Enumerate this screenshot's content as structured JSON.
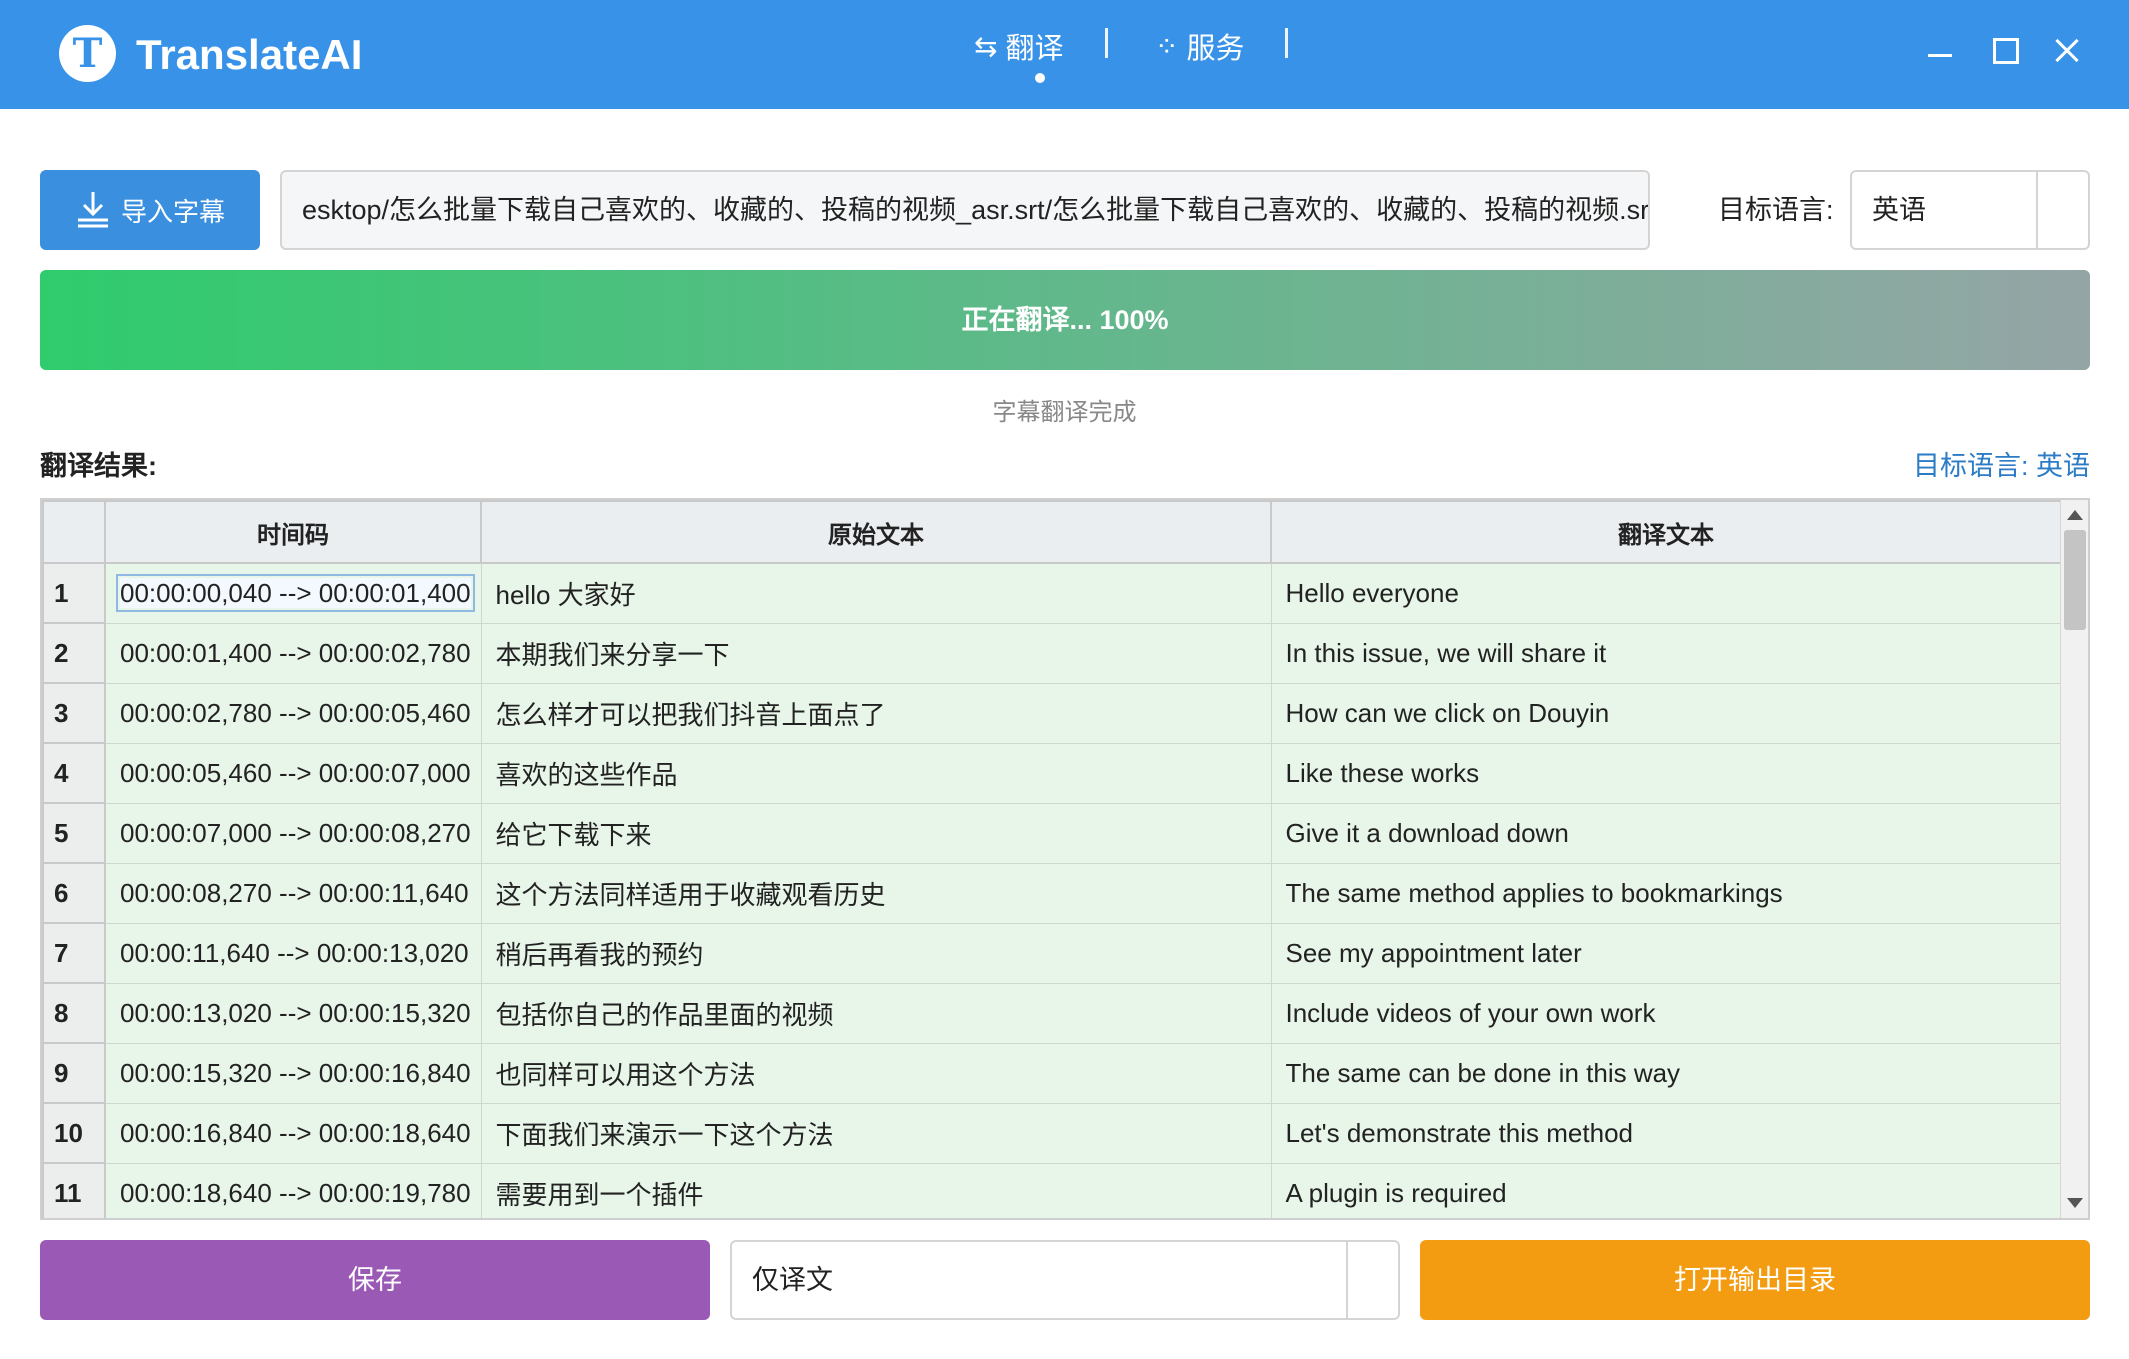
{
  "app": {
    "title": "TranslateAI",
    "logo_letter": "T"
  },
  "nav": {
    "translate_icon": "⇆",
    "translate_label": "翻译",
    "service_icon": "⁘",
    "service_label": "服务",
    "active_tab": "翻译"
  },
  "toolbar": {
    "import_label": "导入字幕",
    "file_path": "esktop/怎么批量下载自己喜欢的、收藏的、投稿的视频_asr.srt/怎么批量下载自己喜欢的、收藏的、投稿的视频.srt",
    "target_label": "目标语言:",
    "target_value": "英语"
  },
  "progress": {
    "text": "正在翻译... 100%",
    "percent": 100,
    "status": "字幕翻译完成"
  },
  "results": {
    "label": "翻译结果:",
    "target_lang": "目标语言: 英语"
  },
  "table": {
    "headers": {
      "timecode": "时间码",
      "original": "原始文本",
      "translated": "翻译文本"
    },
    "rows": [
      {
        "n": "1",
        "tc": "00:00:00,040 --> 00:00:01,400",
        "orig": "hello 大家好",
        "trans": "Hello everyone"
      },
      {
        "n": "2",
        "tc": "00:00:01,400 --> 00:00:02,780",
        "orig": "本期我们来分享一下",
        "trans": "In this issue, we will share it"
      },
      {
        "n": "3",
        "tc": "00:00:02,780 --> 00:00:05,460",
        "orig": "怎么样才可以把我们抖音上面点了",
        "trans": "How can we click on Douyin"
      },
      {
        "n": "4",
        "tc": "00:00:05,460 --> 00:00:07,000",
        "orig": "喜欢的这些作品",
        "trans": "Like these works"
      },
      {
        "n": "5",
        "tc": "00:00:07,000 --> 00:00:08,270",
        "orig": "给它下载下来",
        "trans": "Give it a download down"
      },
      {
        "n": "6",
        "tc": "00:00:08,270 --> 00:00:11,640",
        "orig": "这个方法同样适用于收藏观看历史",
        "trans": "The same method applies to bookmarkings"
      },
      {
        "n": "7",
        "tc": "00:00:11,640 --> 00:00:13,020",
        "orig": "稍后再看我的预约",
        "trans": "See my appointment later"
      },
      {
        "n": "8",
        "tc": "00:00:13,020 --> 00:00:15,320",
        "orig": "包括你自己的作品里面的视频",
        "trans": "Include videos of your own work"
      },
      {
        "n": "9",
        "tc": "00:00:15,320 --> 00:00:16,840",
        "orig": "也同样可以用这个方法",
        "trans": "The same can be done in this way"
      },
      {
        "n": "10",
        "tc": "00:00:16,840 --> 00:00:18,640",
        "orig": "下面我们来演示一下这个方法",
        "trans": "Let's demonstrate this method"
      },
      {
        "n": "11",
        "tc": "00:00:18,640 --> 00:00:19,780",
        "orig": "需要用到一个插件",
        "trans": "A plugin is required"
      }
    ]
  },
  "bottom": {
    "save_label": "保存",
    "mode_value": "仅译文",
    "open_label": "打开输出目录"
  },
  "colors": {
    "titlebar": "#3792e8",
    "import": "#3a8fde",
    "save": "#9b59b6",
    "open": "#f39c12",
    "row_bg": "#e8f5e9"
  }
}
